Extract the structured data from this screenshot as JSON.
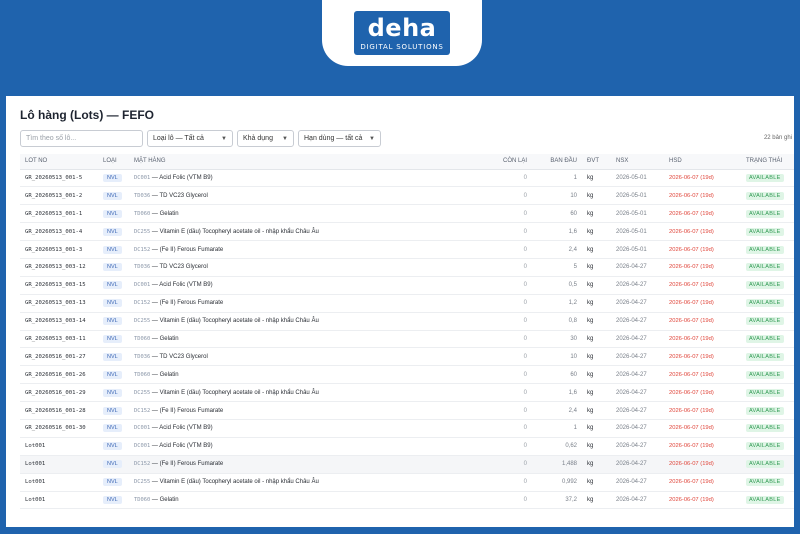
{
  "brand": {
    "word": "deha",
    "sub": "DIGITAL SOLUTIONS"
  },
  "page": {
    "title": "Lô hàng (Lots) — FEFO",
    "count": "22 bản ghi"
  },
  "filters": {
    "search_placeholder": "Tìm theo số lô...",
    "lot_type": "Loại lô — Tất cả",
    "availability": "Khả dụng",
    "expiry": "Hạn dùng — tất cả"
  },
  "table": {
    "headers": [
      "LOT NO",
      "LOẠI",
      "MẶT HÀNG",
      "CÒN LẠI",
      "BAN ĐẦU",
      "ĐVT",
      "NSX",
      "HSD",
      "TRẠNG THÁI"
    ],
    "rows": [
      {
        "lot": "GR_20260513_001-5",
        "type": "NVL",
        "code": "DC001",
        "name": " — Acid Folic (VTM B9)",
        "remain": "0",
        "initial": "1",
        "unit": "kg",
        "nsx": "2026-05-01",
        "hsd": "2026-06-07 (19d)",
        "status": "AVAILABLE"
      },
      {
        "lot": "GR_20260513_001-2",
        "type": "NVL",
        "code": "TD036",
        "name": " — TD VC23 Glycerol",
        "remain": "0",
        "initial": "10",
        "unit": "kg",
        "nsx": "2026-05-01",
        "hsd": "2026-06-07 (19d)",
        "status": "AVAILABLE"
      },
      {
        "lot": "GR_20260513_001-1",
        "type": "NVL",
        "code": "TD060",
        "name": " — Gelatin",
        "remain": "0",
        "initial": "60",
        "unit": "kg",
        "nsx": "2026-05-01",
        "hsd": "2026-06-07 (19d)",
        "status": "AVAILABLE"
      },
      {
        "lot": "GR_20260513_001-4",
        "type": "NVL",
        "code": "DC255",
        "name": " — Vitamin E (dầu) Tocopheryl acetate oil - nhập khẩu Châu Âu",
        "remain": "0",
        "initial": "1,6",
        "unit": "kg",
        "nsx": "2026-05-01",
        "hsd": "2026-06-07 (19d)",
        "status": "AVAILABLE"
      },
      {
        "lot": "GR_20260513_001-3",
        "type": "NVL",
        "code": "DC152",
        "name": " — (Fe II) Ferous Fumarate",
        "remain": "0",
        "initial": "2,4",
        "unit": "kg",
        "nsx": "2026-05-01",
        "hsd": "2026-06-07 (19d)",
        "status": "AVAILABLE"
      },
      {
        "lot": "GR_20260513_003-12",
        "type": "NVL",
        "code": "TD036",
        "name": " — TD VC23 Glycerol",
        "remain": "0",
        "initial": "5",
        "unit": "kg",
        "nsx": "2026-04-27",
        "hsd": "2026-06-07 (19d)",
        "status": "AVAILABLE"
      },
      {
        "lot": "GR_20260513_003-15",
        "type": "NVL",
        "code": "DC001",
        "name": " — Acid Folic (VTM B9)",
        "remain": "0",
        "initial": "0,5",
        "unit": "kg",
        "nsx": "2026-04-27",
        "hsd": "2026-06-07 (19d)",
        "status": "AVAILABLE"
      },
      {
        "lot": "GR_20260513_003-13",
        "type": "NVL",
        "code": "DC152",
        "name": " — (Fe II) Ferous Fumarate",
        "remain": "0",
        "initial": "1,2",
        "unit": "kg",
        "nsx": "2026-04-27",
        "hsd": "2026-06-07 (19d)",
        "status": "AVAILABLE"
      },
      {
        "lot": "GR_20260513_003-14",
        "type": "NVL",
        "code": "DC255",
        "name": " — Vitamin E (dầu) Tocopheryl acetate oil - nhập khẩu Châu Âu",
        "remain": "0",
        "initial": "0,8",
        "unit": "kg",
        "nsx": "2026-04-27",
        "hsd": "2026-06-07 (19d)",
        "status": "AVAILABLE"
      },
      {
        "lot": "GR_20260513_003-11",
        "type": "NVL",
        "code": "TD060",
        "name": " — Gelatin",
        "remain": "0",
        "initial": "30",
        "unit": "kg",
        "nsx": "2026-04-27",
        "hsd": "2026-06-07 (19d)",
        "status": "AVAILABLE"
      },
      {
        "lot": "GR_20260516_001-27",
        "type": "NVL",
        "code": "TD036",
        "name": " — TD VC23 Glycerol",
        "remain": "0",
        "initial": "10",
        "unit": "kg",
        "nsx": "2026-04-27",
        "hsd": "2026-06-07 (19d)",
        "status": "AVAILABLE"
      },
      {
        "lot": "GR_20260516_001-26",
        "type": "NVL",
        "code": "TD060",
        "name": " — Gelatin",
        "remain": "0",
        "initial": "60",
        "unit": "kg",
        "nsx": "2026-04-27",
        "hsd": "2026-06-07 (19d)",
        "status": "AVAILABLE"
      },
      {
        "lot": "GR_20260516_001-29",
        "type": "NVL",
        "code": "DC255",
        "name": " — Vitamin E (dầu) Tocopheryl acetate oil - nhập khẩu Châu Âu",
        "remain": "0",
        "initial": "1,6",
        "unit": "kg",
        "nsx": "2026-04-27",
        "hsd": "2026-06-07 (19d)",
        "status": "AVAILABLE"
      },
      {
        "lot": "GR_20260516_001-28",
        "type": "NVL",
        "code": "DC152",
        "name": " — (Fe II) Ferous Fumarate",
        "remain": "0",
        "initial": "2,4",
        "unit": "kg",
        "nsx": "2026-04-27",
        "hsd": "2026-06-07 (19d)",
        "status": "AVAILABLE"
      },
      {
        "lot": "GR_20260516_001-30",
        "type": "NVL",
        "code": "DC001",
        "name": " — Acid Folic (VTM B9)",
        "remain": "0",
        "initial": "1",
        "unit": "kg",
        "nsx": "2026-04-27",
        "hsd": "2026-06-07 (19d)",
        "status": "AVAILABLE"
      },
      {
        "lot": "Lot001",
        "type": "NVL",
        "code": "DC001",
        "name": " — Acid Folic (VTM B9)",
        "remain": "0",
        "initial": "0,62",
        "unit": "kg",
        "nsx": "2026-04-27",
        "hsd": "2026-06-07 (19d)",
        "status": "AVAILABLE"
      },
      {
        "lot": "Lot001",
        "type": "NVL",
        "code": "DC152",
        "name": " — (Fe II) Ferous Fumarate",
        "remain": "0",
        "initial": "1,488",
        "unit": "kg",
        "nsx": "2026-04-27",
        "hsd": "2026-06-07 (19d)",
        "status": "AVAILABLE"
      },
      {
        "lot": "Lot001",
        "type": "NVL",
        "code": "DC255",
        "name": " — Vitamin E (dầu) Tocopheryl acetate oil - nhập khẩu Châu Âu",
        "remain": "0",
        "initial": "0,992",
        "unit": "kg",
        "nsx": "2026-04-27",
        "hsd": "2026-06-07 (19d)",
        "status": "AVAILABLE"
      },
      {
        "lot": "Lot001",
        "type": "NVL",
        "code": "TD060",
        "name": " — Gelatin",
        "remain": "0",
        "initial": "37,2",
        "unit": "kg",
        "nsx": "2026-04-27",
        "hsd": "2026-06-07 (19d)",
        "status": "AVAILABLE"
      }
    ]
  },
  "colors": {
    "frame": "#1f63ad",
    "expiry": "#e0453a",
    "available_bg": "#dff5e6",
    "available_text": "#2f9a52",
    "nvl_bg": "#e6eefb"
  }
}
